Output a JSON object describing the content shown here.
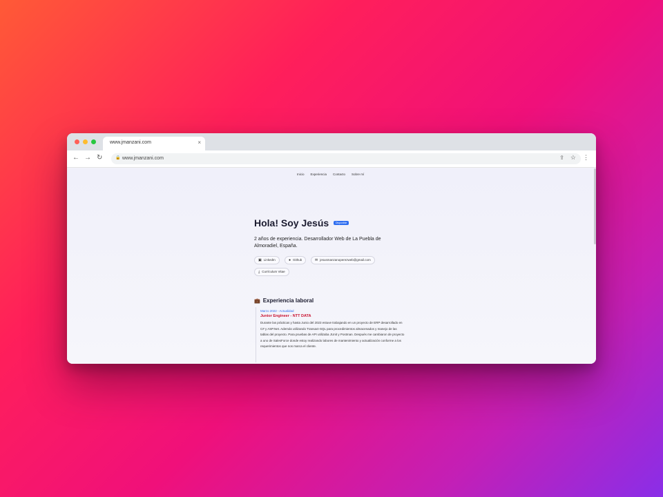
{
  "browser": {
    "tab_title": "www.jmanzani.com",
    "tab_close": "×",
    "url": "www.jmanzani.com",
    "icons": [
      "back-arrow-icon",
      "forward-arrow-icon",
      "reload-icon",
      "lock-icon",
      "share-icon",
      "star-icon",
      "menu-icon"
    ]
  },
  "site": {
    "nav": [
      "Inicio",
      "Experiencia",
      "Contacto",
      "Sobre mí"
    ],
    "hero": {
      "title": "Hola! Soy Jesús",
      "badge": "Disponible",
      "description": "2 años de experiencia. Desarrollador Web de La Puebla de Almoradiel, España."
    },
    "links": {
      "linkedin": "LinkedIn",
      "github": "Github",
      "email": "jesusmanzanoperezweb@gmail.com",
      "cv": "Currículum Vitae"
    },
    "experience": {
      "section_title": "Experiencia laboral",
      "jobs": [
        {
          "date": "Marzo 2022 - Actualidad",
          "title": "Junior Engineer - NTT DATA",
          "description": "Durante las prácticas y hasta Junio del 2023 estuve trabajando en un proyecto de ERP desarrollado en C# y ASP.Net. Además utilizando Transact-SQL para procedimientos almacenados y manejo de las tablas del proyecto. Para pruebas de API utilizaba JUnit y Postman. Después me cambiaron de proyecto a uno de SalesForce donde estoy realizando labores de mantenimiento y actualización conforme a los requerimientos que nos marca el cliente."
        }
      ]
    }
  },
  "colors": {
    "accent": "#2f6ef0",
    "job_title": "#c8102e",
    "page_bg": "#f1f2fb"
  }
}
